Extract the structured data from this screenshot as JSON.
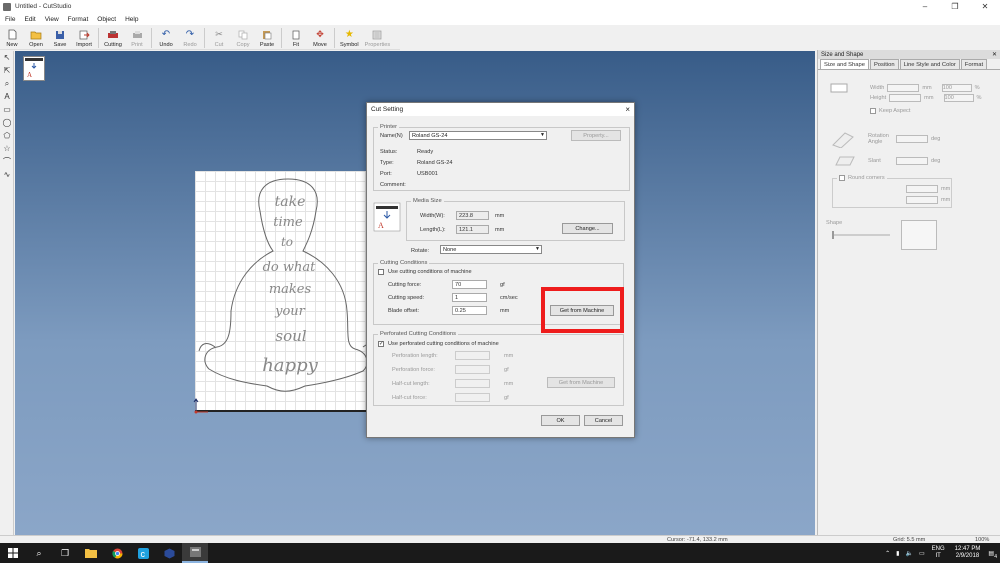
{
  "window": {
    "title": "Untitled - CutStudio"
  },
  "menu": [
    "File",
    "Edit",
    "View",
    "Format",
    "Object",
    "Help"
  ],
  "toolbar": [
    {
      "label": "New",
      "icon": "new-icon",
      "enabled": true
    },
    {
      "label": "Open",
      "icon": "open-icon",
      "enabled": true
    },
    {
      "label": "Save",
      "icon": "save-icon",
      "enabled": true
    },
    {
      "label": "Import",
      "icon": "import-icon",
      "enabled": true
    },
    {
      "label": "Cutting",
      "icon": "cutting-icon",
      "enabled": true
    },
    {
      "label": "Print",
      "icon": "print-icon",
      "enabled": false
    },
    {
      "label": "Undo",
      "icon": "undo-icon",
      "enabled": true
    },
    {
      "label": "Redo",
      "icon": "redo-icon",
      "enabled": false
    },
    {
      "label": "Cut",
      "icon": "cut-icon",
      "enabled": false
    },
    {
      "label": "Copy",
      "icon": "copy-icon",
      "enabled": false
    },
    {
      "label": "Paste",
      "icon": "paste-icon",
      "enabled": true
    },
    {
      "label": "Fit",
      "icon": "fit-icon",
      "enabled": true
    },
    {
      "label": "Move",
      "icon": "move-icon",
      "enabled": true
    },
    {
      "label": "Symbol",
      "icon": "symbol-icon",
      "enabled": true
    },
    {
      "label": "Properties",
      "icon": "properties-icon",
      "enabled": false
    }
  ],
  "left_tools": [
    "select-icon",
    "node-edit-icon",
    "zoom-icon",
    "text-icon",
    "rectangle-icon",
    "ellipse-icon",
    "polygon-icon",
    "star-icon",
    "polyline-icon",
    "curve-icon"
  ],
  "design_text": {
    "lines": [
      "take",
      "time",
      "to",
      "do what",
      "makes",
      "your",
      "soul",
      "happy"
    ]
  },
  "cut_setting": {
    "title": "Cut Setting",
    "close": "×",
    "printer_group": "Printer",
    "name_label": "Name(N)",
    "name_value": "Roland GS-24",
    "property_button": "Property...",
    "status_label": "Status:",
    "status_value": "Ready",
    "type_label": "Type:",
    "type_value": "Roland GS-24",
    "port_label": "Port:",
    "port_value": "USB001",
    "comment_label": "Comment:",
    "media_group": "Media Size",
    "width_label": "Width(W):",
    "width_value": "223.8",
    "width_unit": "mm",
    "length_label": "Length(L):",
    "length_value": "121.1",
    "length_unit": "mm",
    "change_button": "Change...",
    "rotate_label": "Rotate:",
    "rotate_value": "None",
    "cutting_group": "Cutting Conditions",
    "use_machine_label": "Use cutting conditions of machine",
    "force_label": "Cutting force:",
    "force_value": "70",
    "force_unit": "gf",
    "speed_label": "Cutting speed:",
    "speed_value": "1",
    "speed_unit": "cm/sec",
    "offset_label": "Blade offset:",
    "offset_value": "0.25",
    "offset_unit": "mm",
    "get_machine_button": "Get from Machine",
    "perf_group": "Perforated Cutting Conditions",
    "use_perf_label": "Use perforated cutting conditions of machine",
    "perf_length_label": "Perforation length:",
    "perf_length_unit": "mm",
    "perf_force_label": "Perforation force:",
    "perf_force_unit": "gf",
    "half_length_label": "Half-cut length:",
    "half_length_unit": "mm",
    "half_force_label": "Half-cut force:",
    "half_force_unit": "gf",
    "perf_get_button": "Get from Machine",
    "ok_button": "OK",
    "cancel_button": "Cancel"
  },
  "right_panel": {
    "title": "Size and Shape",
    "tabs": [
      "Size and Shape",
      "Position",
      "Line Style and Color",
      "Format"
    ],
    "width_label": "Width",
    "height_label": "Height",
    "unit_mm": "mm",
    "unit_pct": "%",
    "width_pct": "100",
    "height_pct": "100",
    "keep_aspect": "Keep Aspect",
    "rotation_label": "Rotation Angle",
    "deg": "deg",
    "slant_label": "Slant",
    "round_corners": "Round corners",
    "shape_label": "Shape"
  },
  "status": {
    "cursor": "Cursor: -71.4, 133.2 mm",
    "grid": "Grid: 5.5 mm",
    "zoom": "100%"
  },
  "taskbar": {
    "lang_top": "ENG",
    "lang_bottom": "IT",
    "time": "12:47 PM",
    "date": "2/9/2018",
    "notif": "4"
  },
  "colors": {
    "highlight": "#ee1c1c",
    "canvas_top": "#385c88",
    "canvas_bottom": "#8ba6c8"
  }
}
